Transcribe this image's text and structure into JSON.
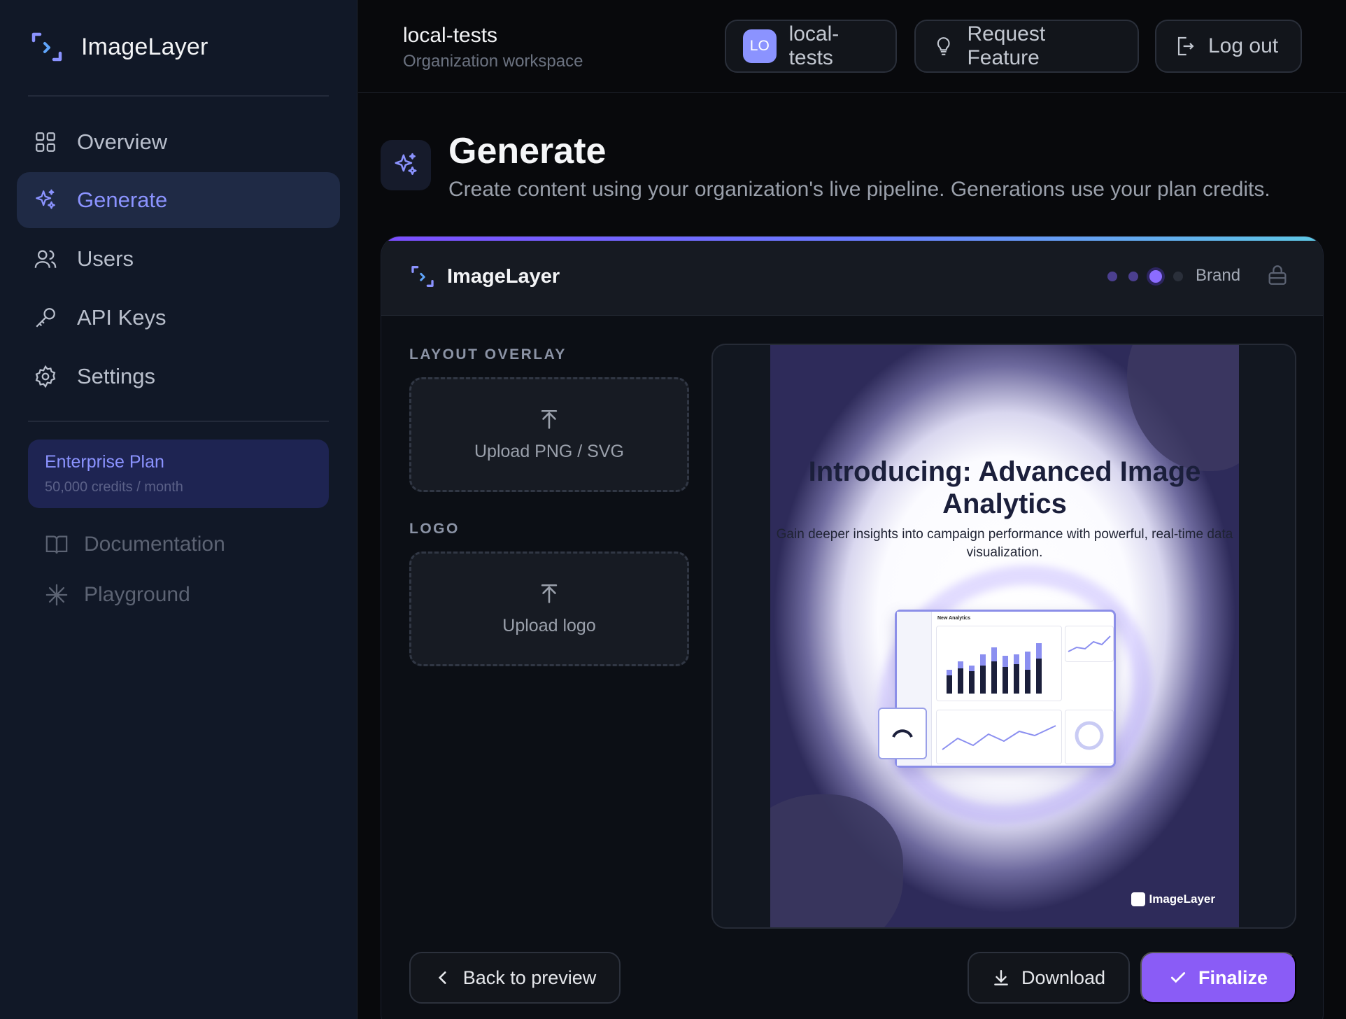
{
  "sidebar": {
    "brand": "ImageLayer",
    "items": [
      {
        "label": "Overview",
        "icon": "grid-icon"
      },
      {
        "label": "Generate",
        "icon": "sparkles-icon",
        "active": true
      },
      {
        "label": "Users",
        "icon": "users-icon"
      },
      {
        "label": "API Keys",
        "icon": "key-icon"
      },
      {
        "label": "Settings",
        "icon": "gear-icon"
      }
    ],
    "plan": {
      "title": "Enterprise Plan",
      "subtitle": "50,000 credits / month"
    },
    "secondary": [
      {
        "label": "Documentation",
        "icon": "book-icon"
      },
      {
        "label": "Playground",
        "icon": "asterisk-icon"
      }
    ]
  },
  "topbar": {
    "workspace_name": "local-tests",
    "workspace_sub": "Organization workspace",
    "org_avatar": "LO",
    "org_name": "local-tests",
    "request_feature": "Request Feature",
    "logout": "Log out"
  },
  "page": {
    "title": "Generate",
    "description": "Create content using your organization's live pipeline. Generations use your plan credits."
  },
  "card": {
    "brand": "ImageLayer",
    "step_label": "Brand",
    "steps_total": 4,
    "current_step": 3,
    "layout_overlay_label": "LAYOUT OVERLAY",
    "layout_overlay_upload": "Upload PNG / SVG",
    "logo_label": "LOGO",
    "logo_upload": "Upload logo",
    "preview": {
      "title": "Introducing: Advanced Image Analytics",
      "subtitle": "Gain deeper insights into campaign performance with powerful, real-time data visualization.",
      "dashboard_title": "New Analytics",
      "logo_text": "ImageLayer"
    },
    "back_label": "Back to preview",
    "download_label": "Download",
    "finalize_label": "Finalize"
  },
  "colors": {
    "accent": "#8a5cf6",
    "nav_active": "#8b93ff",
    "sidebar_bg": "#111827"
  }
}
